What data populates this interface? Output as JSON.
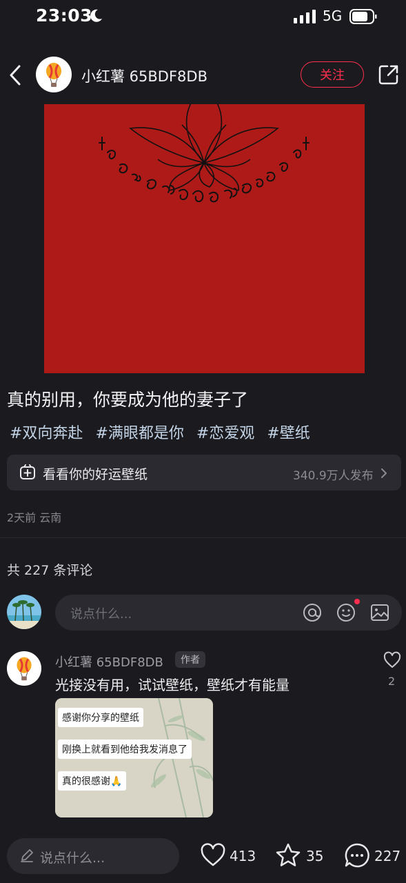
{
  "status_bar": {
    "time": "23:03",
    "network": "5G"
  },
  "header": {
    "username": "小红薯 65BDF8DB",
    "follow_label": "关注"
  },
  "post": {
    "title": "真的别用，你要成为他的妻子了",
    "tags": [
      "#双向奔赴",
      "#满眼都是你",
      "#恋爱观",
      "#壁纸"
    ],
    "promo": {
      "text": "看看你的好运壁纸",
      "count": "340.9万人发布"
    },
    "meta": "2天前 云南"
  },
  "comments": {
    "count_label": "共 227 条评论",
    "input_placeholder": "说点什么...",
    "items": [
      {
        "author": "小红薯 65BDF8DB",
        "badge": "作者",
        "text": "光接没有用，试试壁纸，壁纸才有能量",
        "likes": "2",
        "image_bubbles": [
          "感谢你分享的壁纸",
          "刚换上就看到他给我发消息了",
          "真的很感谢🙏"
        ]
      }
    ]
  },
  "bottom_bar": {
    "input_placeholder": "说点什么...",
    "likes": "413",
    "stars": "35",
    "comments": "227"
  },
  "colors": {
    "accent": "#ff2e4d",
    "image_red": "#ad1a18",
    "background": "#1b1b1f"
  }
}
